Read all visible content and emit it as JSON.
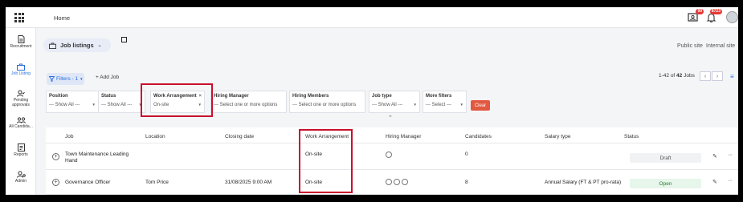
{
  "topbar": {
    "home_label": "Home",
    "notif_badge_1": "99",
    "notif_badge_2": "8723"
  },
  "sidebar": {
    "items": [
      {
        "label": "Recruitment",
        "icon": "document-icon"
      },
      {
        "label": "Job Listing",
        "icon": "briefcase-icon"
      },
      {
        "label": "Pending approvals",
        "icon": "user-check-icon"
      },
      {
        "label": "All Candida...",
        "icon": "users-icon"
      },
      {
        "label": "Reports",
        "icon": "report-icon"
      },
      {
        "label": "Admin",
        "icon": "admin-icon"
      }
    ]
  },
  "header": {
    "job_listings_label": "Job listings",
    "public_site": "Public site",
    "internal_site": "Internal site"
  },
  "toolbar": {
    "filters_label": "Filters - 1",
    "add_job_label": "+ Add Job",
    "count_prefix": "1-42 of ",
    "count_total": "42",
    "count_suffix": " Jobs"
  },
  "filters": [
    {
      "label": "Position",
      "value": "--- Show All ---"
    },
    {
      "label": "Status",
      "value": "--- Show All ---"
    },
    {
      "label": "Work Arrangement",
      "value": "On-site",
      "clearable": true
    },
    {
      "label": "Hiring Manager",
      "value": "--- Select one or more options"
    },
    {
      "label": "Hiring Members",
      "value": "--- Select one or more options"
    },
    {
      "label": "Job type",
      "value": "--- Show All ---"
    },
    {
      "label": "More filters",
      "value": "--- Select ---"
    }
  ],
  "clear_label": "Clear",
  "table": {
    "headers": [
      "Job",
      "Location",
      "Closing date",
      "Work Arrangement",
      "Hiring Manager",
      "Candidates",
      "Salary type",
      "Status"
    ],
    "rows": [
      {
        "job": "Town Maintenance Leading Hand",
        "location": "",
        "closing": "",
        "work": "On-site",
        "managers": 1,
        "candidates": "0",
        "salary": "",
        "status": "Draft"
      },
      {
        "job": "Governance Officer",
        "location": "Tom Price",
        "closing": "31/08/2025 9:00 AM",
        "work": "On-site",
        "managers": 3,
        "candidates": "8",
        "salary": "Annual Salary (FT & PT pro-rata)",
        "status": "Open"
      }
    ]
  },
  "colors": {
    "accent": "#2a6fdb",
    "highlight": "#c8102e",
    "clear_button": "#e25840",
    "open_status": "#e6f6ea",
    "draft_status": "#f1f2f4"
  }
}
